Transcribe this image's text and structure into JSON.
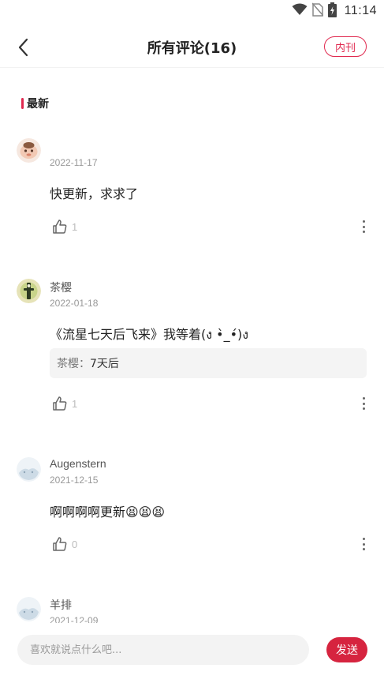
{
  "status_bar": {
    "time": "11:14",
    "icons": [
      "wifi-icon",
      "no-sim-icon",
      "battery-charging-icon"
    ]
  },
  "header": {
    "title": "所有评论(16)",
    "tag_label": "内刊",
    "back_icon": "back-arrow-icon"
  },
  "section": {
    "title": "最新",
    "accent_color": "#e0294f"
  },
  "comments": [
    {
      "name": "",
      "date": "2022-11-17",
      "text": "快更新，求求了",
      "likes": "1",
      "avatar": "cartoon-face-avatar"
    },
    {
      "name": "茶樱",
      "date": "2022-01-18",
      "text": "《流星七天后飞来》我等着(ง •̀_•́)ง",
      "reply": {
        "name": "茶樱：",
        "text": "7天后"
      },
      "likes": "1",
      "avatar": "character-avatar"
    },
    {
      "name": "Augenstern",
      "date": "2021-12-15",
      "text": "啊啊啊啊更新😫😫😫",
      "likes": "0",
      "avatar": "snow-avatar"
    },
    {
      "name": "羊排",
      "date": "2021-12-09",
      "avatar": "snow-avatar"
    }
  ],
  "bottom_bar": {
    "input_placeholder": "喜欢就说点什么吧...",
    "send_label": "发送",
    "send_color": "#d6243f"
  }
}
